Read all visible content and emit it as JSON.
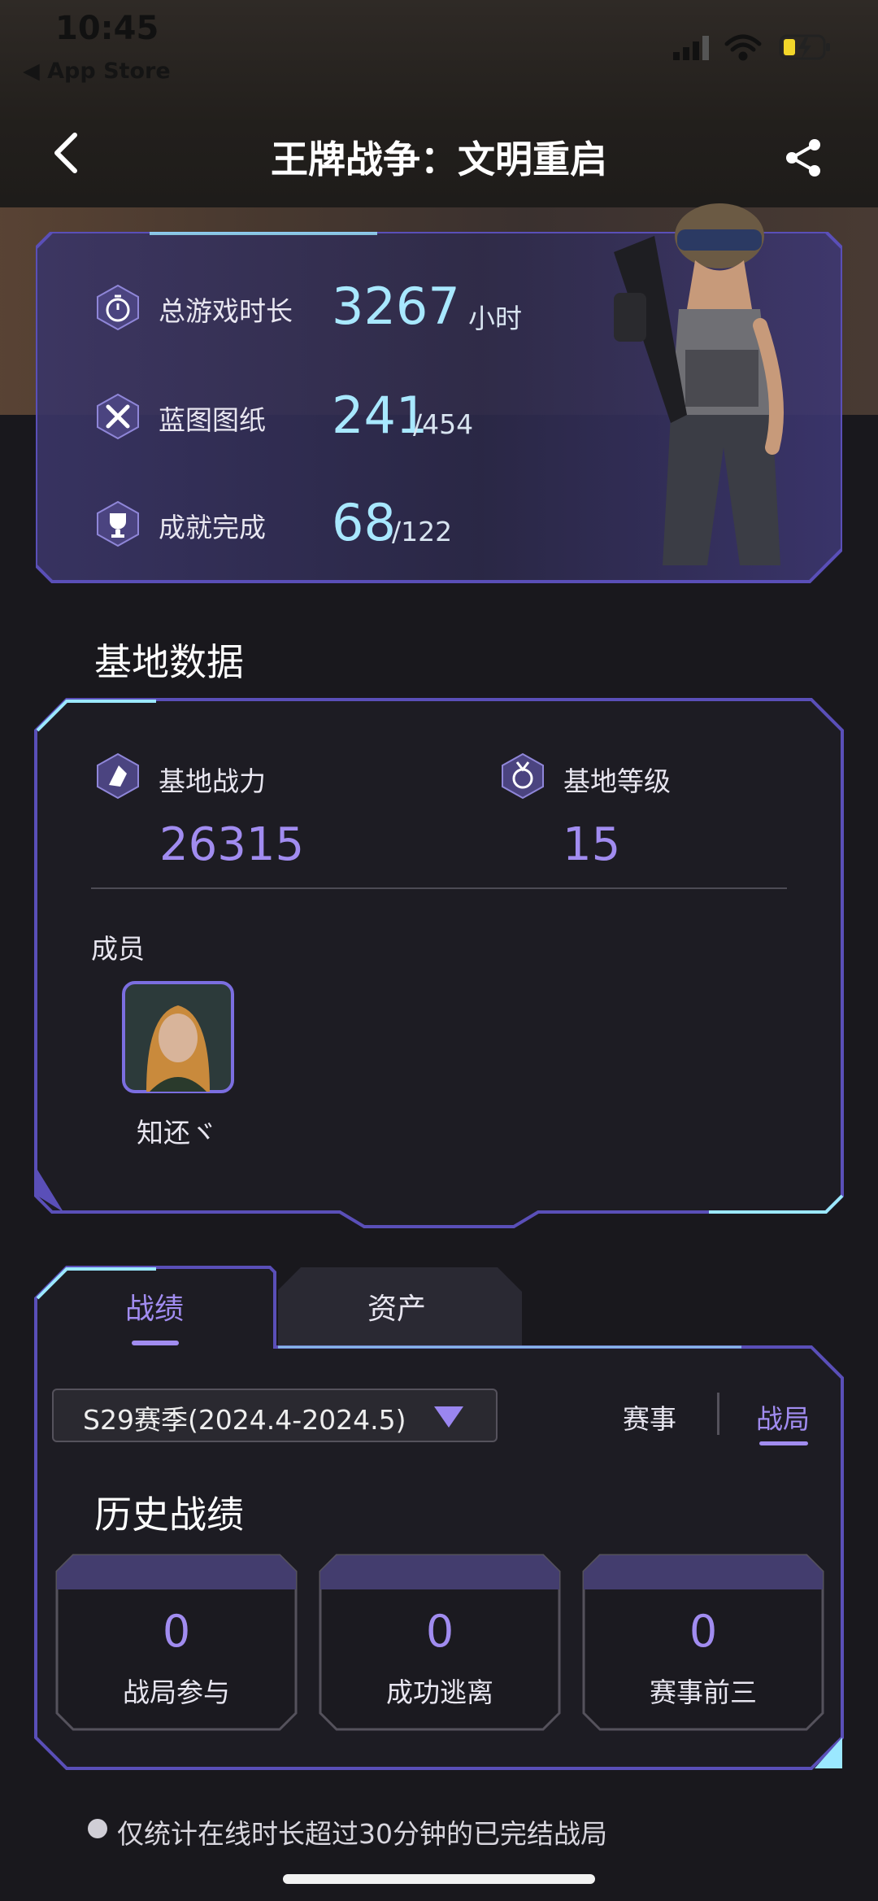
{
  "status_bar": {
    "time": "10:45",
    "back_app": "◀ App Store"
  },
  "nav": {
    "title": "王牌战争：文明重启"
  },
  "summary": [
    {
      "label": "总游戏时长",
      "value": "3267",
      "suffix": "小时",
      "icon": "stopwatch-icon"
    },
    {
      "label": "蓝图图纸",
      "value": "241",
      "suffix": "/454",
      "icon": "blueprint-icon"
    },
    {
      "label": "成就完成",
      "value": "68",
      "suffix": "/122",
      "icon": "trophy-icon"
    }
  ],
  "base": {
    "section_title": "基地数据",
    "power_label": "基地战力",
    "power_value": "26315",
    "level_label": "基地等级",
    "level_value": "15",
    "members_label": "成员",
    "member_name": "知还ヾ"
  },
  "tabs": {
    "record": "战绩",
    "assets": "资产"
  },
  "filter": {
    "season": "S29赛季(2024.4-2024.5)",
    "option_event": "赛事",
    "option_match": "战局"
  },
  "history": {
    "title": "历史战绩",
    "boxes": [
      {
        "value": "0",
        "label": "战局参与"
      },
      {
        "value": "0",
        "label": "成功逃离"
      },
      {
        "value": "0",
        "label": "赛事前三"
      }
    ]
  },
  "footnote": "仅统计在线时长超过30分钟的已完结战局",
  "colors": {
    "accent": "#a18cf0",
    "highlight": "#a8e8ff",
    "border": "#5a4fb8"
  }
}
